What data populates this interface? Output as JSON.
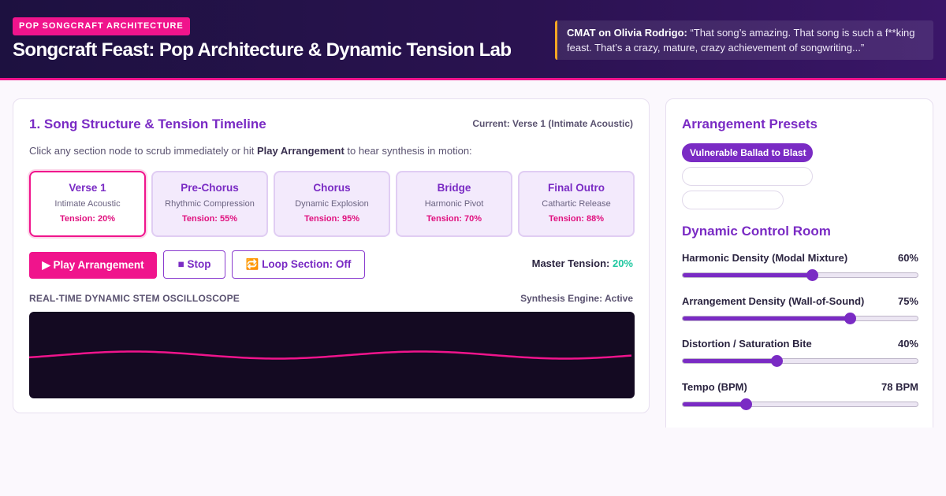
{
  "header": {
    "tag": "POP SONGCRAFT ARCHITECTURE",
    "title": "Songcraft Feast: Pop Architecture & Dynamic Tension Lab",
    "quote_author": "CMAT on Olivia Rodrigo:",
    "quote_text": "“That song’s amazing. That song is such a f**king feast. That’s a crazy, mature, crazy achievement of songwriting...”"
  },
  "timeline": {
    "title": "1. Song Structure & Tension Timeline",
    "current": "Current: Verse 1 (Intimate Acoustic)",
    "instructions_pre": "Click any section node to scrub immediately or hit ",
    "instructions_bold": "Play Arrangement",
    "instructions_post": " to hear synthesis in motion:",
    "sections": [
      {
        "name": "Verse 1",
        "desc": "Intimate Acoustic",
        "tension": "Tension: 20%",
        "active": true
      },
      {
        "name": "Pre-Chorus",
        "desc": "Rhythmic Compression",
        "tension": "Tension: 55%",
        "active": false
      },
      {
        "name": "Chorus",
        "desc": "Dynamic Explosion",
        "tension": "Tension: 95%",
        "active": false
      },
      {
        "name": "Bridge",
        "desc": "Harmonic Pivot",
        "tension": "Tension: 70%",
        "active": false
      },
      {
        "name": "Final Outro",
        "desc": "Cathartic Release",
        "tension": "Tension: 88%",
        "active": false
      }
    ],
    "play_label": "▶ Play Arrangement",
    "stop_label": "■ Stop",
    "loop_label": "🔁 Loop Section: Off",
    "master_label": "Master Tension: ",
    "master_value": "20%",
    "osc_label": "REAL-TIME DYNAMIC STEM OSCILLOSCOPE",
    "engine_status": "Synthesis Engine: Active"
  },
  "presets": {
    "title": "Arrangement Presets",
    "items": [
      {
        "label": "Vulnerable Ballad to Blast",
        "selected": true
      },
      {
        "label": "",
        "selected": false
      },
      {
        "label": "",
        "selected": false
      }
    ]
  },
  "controls": {
    "title": "Dynamic Control Room",
    "sliders": [
      {
        "label": "Harmonic Density (Modal Mixture)",
        "value": "60%",
        "fraction": 0.55
      },
      {
        "label": "Arrangement Density (Wall-of-Sound)",
        "value": "75%",
        "fraction": 0.71
      },
      {
        "label": "Distortion / Saturation Bite",
        "value": "40%",
        "fraction": 0.4
      },
      {
        "label": "Tempo (BPM)",
        "value": "78 BPM",
        "fraction": 0.27
      }
    ]
  },
  "colors": {
    "accent_pink": "#f0148c",
    "accent_purple": "#7a2bc4",
    "tension_green": "#1fc7a0",
    "osc_bg": "#140a22"
  }
}
